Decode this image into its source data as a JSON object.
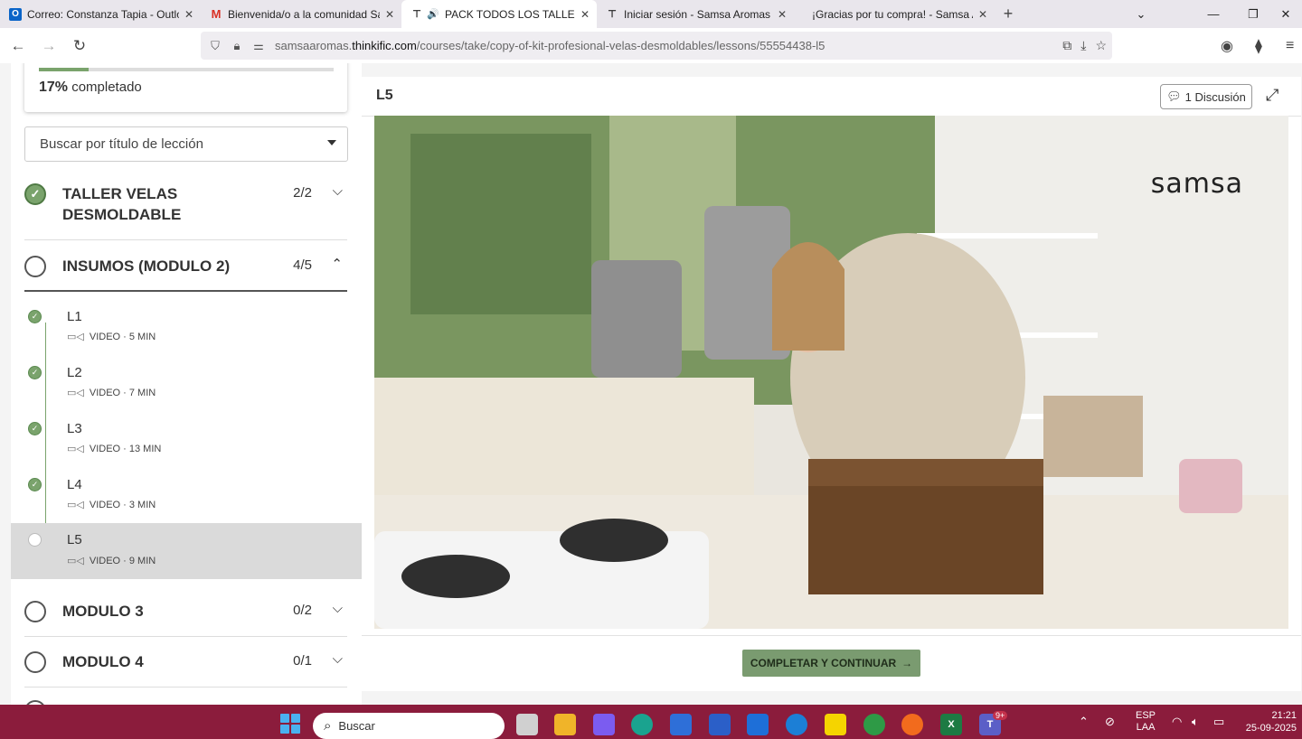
{
  "browser": {
    "tabs": [
      {
        "title": "Correo: Constanza Tapia - Outlo",
        "icon": "outlook-icon",
        "color": "#0a64c8"
      },
      {
        "title": "Bienvenida/o a la comunidad Sa",
        "icon": "gmail-icon",
        "color": "#d93025"
      },
      {
        "title": "PACK TODOS LOS TALLERES",
        "icon": "thinkific-icon",
        "active": true
      },
      {
        "title": "Iniciar sesión - Samsa Aromas",
        "icon": "thinkific-icon"
      },
      {
        "title": "¡Gracias por tu compra! - Samsa Ar",
        "icon": "page-icon"
      }
    ],
    "url_prefix": "samsaaromas.",
    "url_domain": "thinkific.com",
    "url_path": "/courses/take/copy-of-kit-profesional-velas-desmoldables/lessons/55554438-l5"
  },
  "sidebar": {
    "progress_percent": 17,
    "progress_pct_text": "17%",
    "progress_text": " completado",
    "search_placeholder": "Buscar por título de lección",
    "chapters": [
      {
        "title": "TALLER VELAS DESMOLDABLE",
        "count": "2/2",
        "completed": true,
        "expanded": false
      },
      {
        "title": "INSUMOS (MODULO 2)",
        "count": "4/5",
        "completed": false,
        "expanded": true
      },
      {
        "title": "MODULO 3",
        "count": "0/2",
        "completed": false,
        "expanded": false
      },
      {
        "title": "MODULO 4",
        "count": "0/1",
        "completed": false,
        "expanded": false
      }
    ],
    "lessons": [
      {
        "name": "L1",
        "meta": "VIDEO · 5 MIN",
        "done": true
      },
      {
        "name": "L2",
        "meta": "VIDEO · 7 MIN",
        "done": true
      },
      {
        "name": "L3",
        "meta": "VIDEO · 13 MIN",
        "done": true
      },
      {
        "name": "L4",
        "meta": "VIDEO · 3 MIN",
        "done": true
      },
      {
        "name": "L5",
        "meta": "VIDEO · 9 MIN",
        "done": false,
        "active": true
      }
    ]
  },
  "main": {
    "lesson_title": "L5",
    "discussion_label": "1 Discusión",
    "video_logo": "samsa",
    "complete_button": "COMPLETAR Y CONTINUAR",
    "complete_color": "#7a9b70"
  },
  "taskbar": {
    "search_placeholder": "Buscar",
    "language": "ESP",
    "layout": "LAA",
    "time": "21:21",
    "date": "25-09-2025",
    "teams_badge": "9+",
    "color": "#8b1c3c"
  }
}
